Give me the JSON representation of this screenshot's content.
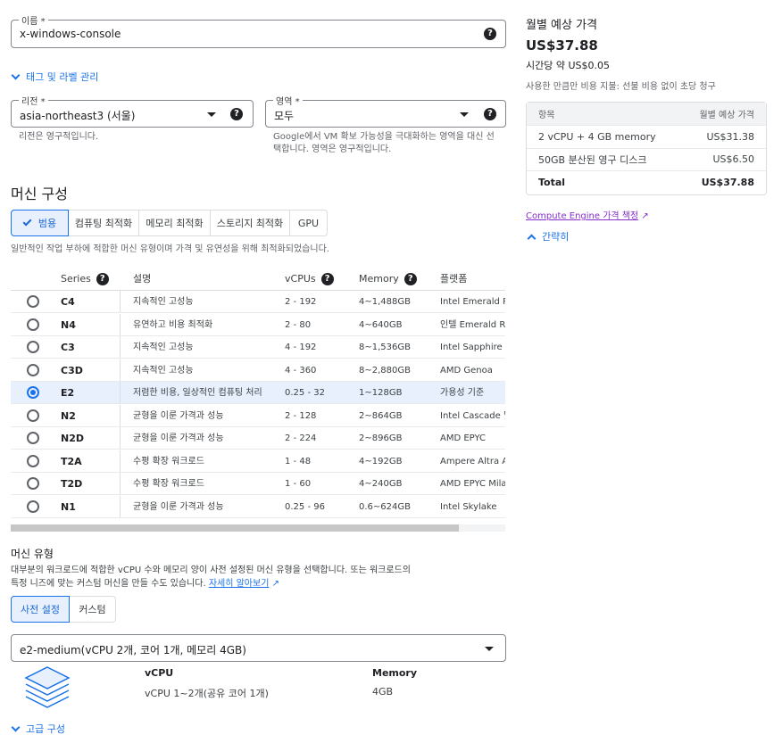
{
  "name_field": {
    "label": "이름 *",
    "value": "x-windows-console"
  },
  "tags_link": "태그 및 라벨 관리",
  "region": {
    "label": "리전 *",
    "value": "asia-northeast3 (서울)",
    "hint": "리전은 영구적입니다."
  },
  "zone": {
    "label": "영역 *",
    "value": "모두",
    "hint": "Google에서 VM 확보 가능성을 극대화하는 영역을 대신 선택합니다. 영역은 영구적입니다."
  },
  "machine_config": {
    "title": "머신 구성",
    "tabs": [
      "범용",
      "컴퓨팅 최적화",
      "메모리 최적화",
      "스토리지 최적화",
      "GPU"
    ],
    "description": "일반적인 작업 부하에 적합한 머신 유형이며 가격 및 유연성을 위해 최적화되었습니다."
  },
  "series_table": {
    "headers": {
      "series": "Series",
      "desc": "설명",
      "vcpus": "vCPUs",
      "memory": "Memory",
      "platform": "플랫폼"
    },
    "rows": [
      {
        "series": "C4",
        "desc": "지속적인 고성능",
        "vcpus": "2 - 192",
        "memory": "4~1,488GB",
        "platform": "Intel Emerald Ra",
        "selected": false
      },
      {
        "series": "N4",
        "desc": "유연하고 비용 최적화",
        "vcpus": "2 - 80",
        "memory": "4~640GB",
        "platform": "인텔 Emerald Ra",
        "selected": false
      },
      {
        "series": "C3",
        "desc": "지속적인 고성능",
        "vcpus": "4 - 192",
        "memory": "8~1,536GB",
        "platform": "Intel Sapphire R",
        "selected": false
      },
      {
        "series": "C3D",
        "desc": "지속적인 고성능",
        "vcpus": "4 - 360",
        "memory": "8~2,880GB",
        "platform": "AMD Genoa",
        "selected": false
      },
      {
        "series": "E2",
        "desc": "저렴한 비용, 일상적인 컴퓨팅 처리",
        "vcpus": "0.25 - 32",
        "memory": "1~128GB",
        "platform": "가용성 기준",
        "selected": true
      },
      {
        "series": "N2",
        "desc": "균형을 이룬 가격과 성능",
        "vcpus": "2 - 128",
        "memory": "2~864GB",
        "platform": "Intel Cascade 및",
        "selected": false
      },
      {
        "series": "N2D",
        "desc": "균형을 이룬 가격과 성능",
        "vcpus": "2 - 224",
        "memory": "2~896GB",
        "platform": "AMD EPYC",
        "selected": false
      },
      {
        "series": "T2A",
        "desc": "수평 확장 워크로드",
        "vcpus": "1 - 48",
        "memory": "4~192GB",
        "platform": "Ampere Altra AF",
        "selected": false
      },
      {
        "series": "T2D",
        "desc": "수평 확장 워크로드",
        "vcpus": "1 - 60",
        "memory": "4~240GB",
        "platform": "AMD EPYC Mila",
        "selected": false
      },
      {
        "series": "N1",
        "desc": "균형을 이룬 가격과 성능",
        "vcpus": "0.25 - 96",
        "memory": "0.6~624GB",
        "platform": "Intel Skylake",
        "selected": false
      }
    ]
  },
  "machine_type": {
    "title": "머신 유형",
    "description": "대부분의 워크로드에 적합한 vCPU 수와 메모리 양이 사전 설정된 머신 유형을 선택합니다. 또는 워크로드의 특정 니즈에 맞는 커스텀 머신을 만들 수도 있습니다.",
    "learn_more": "자세히 알아보기",
    "tabs": [
      "사전 설정",
      "커스텀"
    ],
    "selected": "e2-medium(vCPU 2개, 코어 1개, 메모리 4GB)",
    "vcpu_label": "vCPU",
    "vcpu_value": "vCPU 1~2개(공유 코어 1개)",
    "memory_label": "Memory",
    "memory_value": "4GB"
  },
  "advanced_link": "고급 구성",
  "pricing": {
    "title": "월별 예상 가격",
    "amount": "US$37.88",
    "hourly": "시간당 약 US$0.05",
    "note": "사용한 만큼만 비용 지불: 선불 비용 없이 초당 청구",
    "header_item": "항목",
    "header_cost": "월별 예상 가격",
    "items": [
      {
        "name": "2 vCPU + 4 GB memory",
        "cost": "US$31.38"
      },
      {
        "name": "50GB 분산된 영구 디스크",
        "cost": "US$6.50"
      }
    ],
    "total_label": "Total",
    "total_value": "US$37.88",
    "pricing_link": "Compute Engine 가격 책정",
    "collapse_link": "간략히"
  },
  "colors": {
    "accent": "#1a73e8",
    "selected_bg": "#e8f0fe"
  },
  "icons": [
    "help-icon",
    "chevron-down-icon",
    "chevron-up-icon",
    "dropdown-caret-icon",
    "check-icon",
    "external-link-icon",
    "layers-icon",
    "radio-icon"
  ]
}
